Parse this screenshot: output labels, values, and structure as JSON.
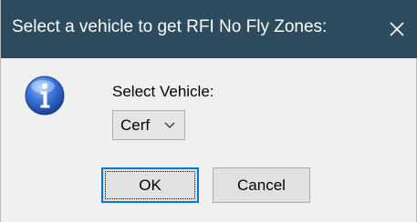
{
  "window": {
    "title": "Select a vehicle to get RFI No Fly Zones:",
    "titlebar_color": "#2c4b5e",
    "close_icon": "close-icon"
  },
  "content": {
    "icon": "info-icon",
    "label": "Select Vehicle:",
    "vehicle_select": {
      "selected": "Cerf"
    }
  },
  "buttons": {
    "ok_label": "OK",
    "cancel_label": "Cancel"
  }
}
